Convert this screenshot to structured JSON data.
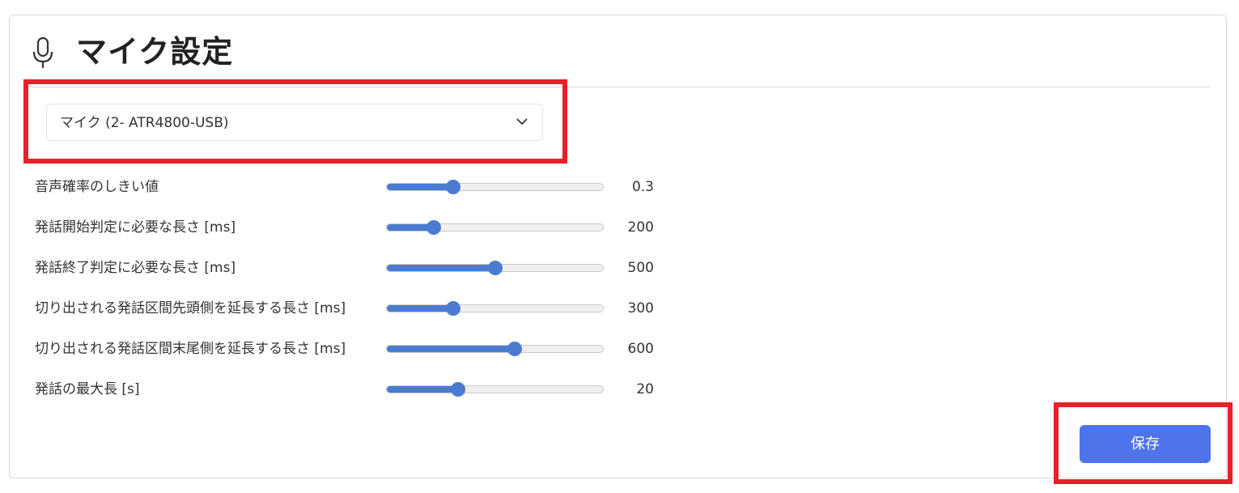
{
  "header": {
    "icon": "microphone-icon",
    "title": "マイク設定"
  },
  "microphone_select": {
    "selected": "マイク (2- ATR4800-USB)",
    "icon": "chevron-down-icon"
  },
  "settings": [
    {
      "label": "音声確率のしきい値",
      "value": "0.3",
      "level": 0.31
    },
    {
      "label": "発話開始判定に必要な長さ [ms]",
      "value": "200",
      "level": 0.22
    },
    {
      "label": "発話終了判定に必要な長さ [ms]",
      "value": "500",
      "level": 0.5
    },
    {
      "label": "切り出される発話区間先頭側を延長する長さ [ms]",
      "value": "300",
      "level": 0.31
    },
    {
      "label": "切り出される発話区間末尾側を延長する長さ [ms]",
      "value": "600",
      "level": 0.59
    },
    {
      "label": "発話の最大長 [s]",
      "value": "20",
      "level": 0.33
    }
  ],
  "actions": {
    "save_label": "保存"
  },
  "colors": {
    "accent": "#4a7bd0",
    "button": "#4f73ea",
    "highlight": "#e8202a"
  }
}
